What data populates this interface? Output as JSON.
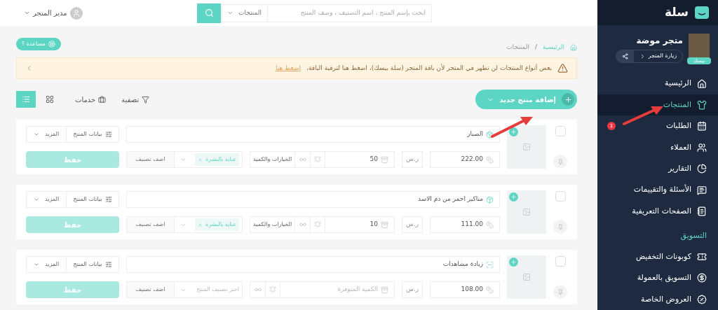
{
  "topbar": {
    "search": {
      "placeholder": "ابحث بإسم المنتج ، اسم التصنيف ، وصف المنتج"
    },
    "scope": "المنتجات",
    "user": "مدير المتجر"
  },
  "sidebar": {
    "logo": "سلة",
    "store": {
      "name": "متجر موضة",
      "badge": "بيسك",
      "visit": "زيارة المتجر"
    },
    "items": [
      {
        "label": "الرئيسية",
        "selected": false
      },
      {
        "label": "المنتجات",
        "selected": true
      },
      {
        "label": "الطلبات",
        "selected": false,
        "badge": "1"
      },
      {
        "label": "العملاء",
        "selected": false
      },
      {
        "label": "التقارير",
        "selected": false
      },
      {
        "label": "الأسئلة والتقييمات",
        "selected": false
      },
      {
        "label": "الصفحات التعريفية",
        "selected": false
      }
    ],
    "section": "التسويق",
    "marketing": [
      {
        "label": "كوبونات التخفيض",
        "selected": false
      },
      {
        "label": "التسويق بالعمولة",
        "selected": false
      },
      {
        "label": "العروض الخاصة",
        "selected": false
      }
    ]
  },
  "help": "مساعدة ؟",
  "breadcrumb": [
    "الرئيسية",
    "المنتجات"
  ],
  "breadcrumb_separator": "/",
  "alert": {
    "text": "بعض أنواع المنتجات لن تظهر في المتجر لأن باقة المتجر (سلة بيسك)، اضغط هنا لترقية الباقة،",
    "link": "إضغط هنا"
  },
  "toolbar": {
    "add": "إضافة منتج جديد",
    "filter": "تصفية",
    "services": "خدمات",
    "views": [
      {
        "kind": "list",
        "selected": true
      },
      {
        "kind": "grid",
        "selected": false
      }
    ]
  },
  "products": [
    {
      "kind": "product",
      "checked": false,
      "name": "الصبار",
      "price": "222.00",
      "currency": "ر.س",
      "quantity": "50",
      "options": "الخيارات والكمية",
      "tag": "عناية بالبشرة",
      "add_category": "اضف تصنيف",
      "data": "بيانات المنتج",
      "more": "المزيد",
      "save": "حفظ"
    },
    {
      "kind": "product",
      "checked": false,
      "name": "مناكير احمر من دم الاسد",
      "price": "111.00",
      "currency": "ر.س",
      "quantity": "10",
      "options": "الخيارات والكمية",
      "tag": "عناية بالبشرة",
      "add_category": "اضف تصنيف",
      "data": "بيانات المنتج",
      "more": "المزيد",
      "save": "حفظ"
    },
    {
      "kind": "service",
      "checked": false,
      "name": "زيادة مشاهدات",
      "price": "108.00",
      "currency": "ر.س",
      "quantity_placeholder": "الكمية المتوفرة",
      "category_placeholder": "اختر تصنيف المنتج",
      "add_category": "اضف تصنيف",
      "data": "بيانات المنتج",
      "more": "المزيد",
      "save": "حفظ"
    }
  ]
}
